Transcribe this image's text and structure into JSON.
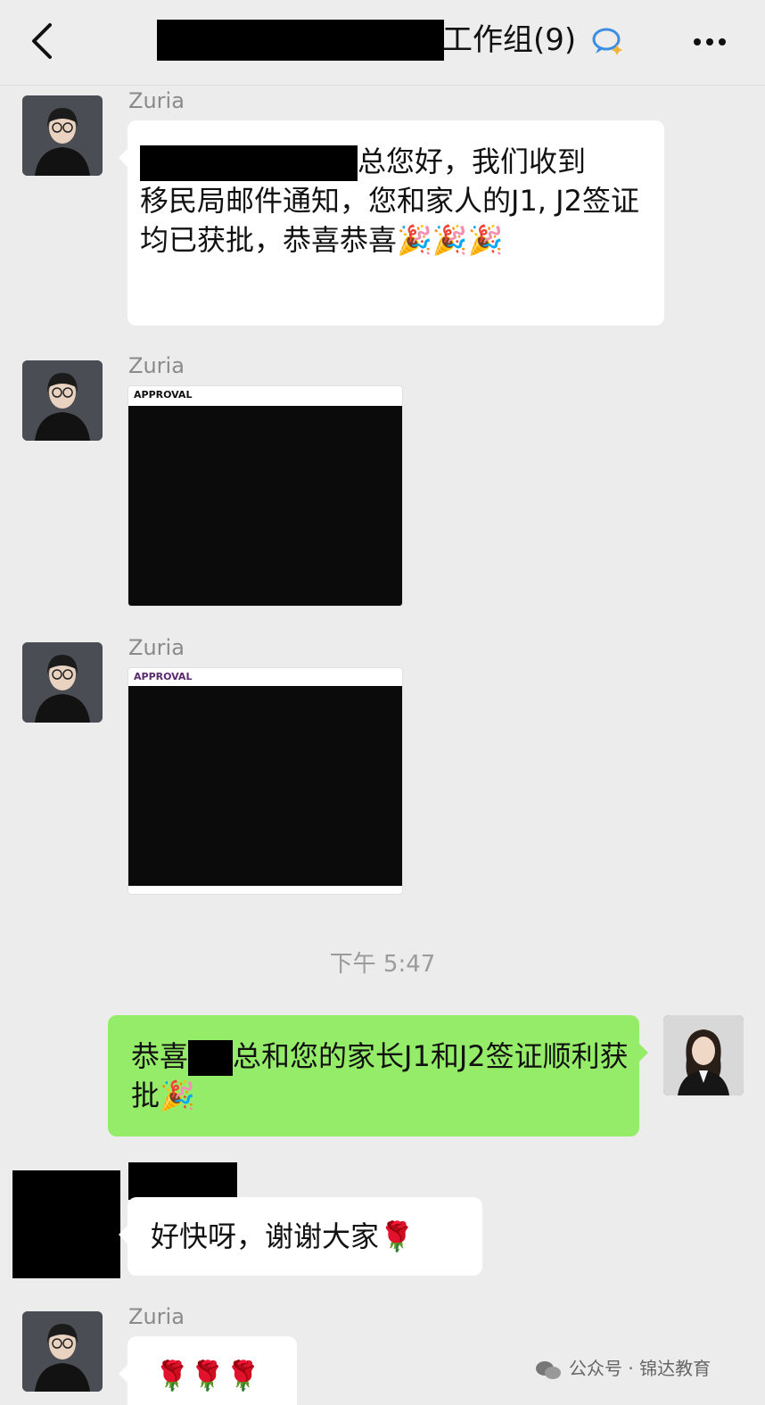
{
  "header": {
    "title": "工作组(9)",
    "back_icon": "chevron-left-icon",
    "group_icon": "chat-bubble-icon",
    "more_icon": "more-dots-icon"
  },
  "messages": [
    {
      "sender": "Zuria",
      "text_after_redaction": "总您好，我们收到",
      "text_rest": "移民局邮件通知，您和家人的J1, J2签证均已获批，恭喜恭喜🎉🎉🎉"
    },
    {
      "sender": "Zuria",
      "image_label": "APPROVAL"
    },
    {
      "sender": "Zuria",
      "image_label": "APPROVAL"
    },
    {
      "text_before_redaction": "恭喜",
      "text_after_redaction": "总和您的家长J1和J2签证顺利获批🎉"
    },
    {
      "text": "好快呀，谢谢大家🌹"
    },
    {
      "sender": "Zuria",
      "text": "🌹🌹🌹"
    }
  ],
  "timestamp": "下午 5:47",
  "watermark": "公众号 · 锦达教育",
  "colors": {
    "background": "#ececec",
    "green_bubble": "#95ec69",
    "white_bubble": "#ffffff",
    "approval_purple": "#5a2a6e"
  }
}
